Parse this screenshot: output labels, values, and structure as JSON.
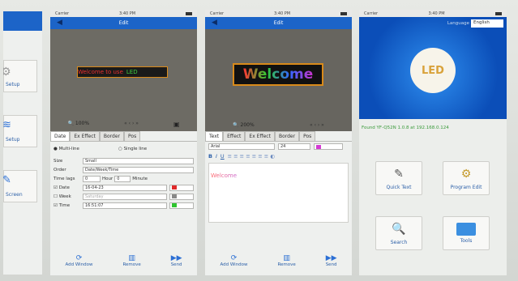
{
  "left_screen": {
    "menu_items": [
      {
        "label": "Setup",
        "icon": "gear-icon"
      },
      {
        "label": "Setup",
        "icon": "wifi-icon"
      },
      {
        "label": "Screen",
        "icon": "pencil-icon"
      }
    ]
  },
  "screen2": {
    "status_carrier": "Carrier",
    "status_time": "3:40 PM",
    "title": "Edit",
    "preview_text": "Welcome to use",
    "preview_text2": "LED",
    "zoom_label": "100%",
    "tabs": [
      "Date",
      "Ex Effect",
      "Border",
      "Pos"
    ],
    "radio_multiline": "Multi-line",
    "radio_singleline": "Single line",
    "size_label": "Size",
    "size_value": "Small",
    "order_label": "Order",
    "order_value": "Date/Week/Time",
    "timelag_label": "Time lags",
    "timelag_day": "0",
    "timelag_hour_label": "Hour",
    "timelag_hour": "0",
    "timelag_minute_label": "Minute",
    "date_label": "Date",
    "date_value": "16-04-23",
    "week_label": "Week",
    "week_value": "Saturday",
    "time_label": "Time",
    "time_value": "16:51:07",
    "bottom_buttons": [
      "Add Window",
      "Remove",
      "Send"
    ]
  },
  "screen3": {
    "status_carrier": "Carrier",
    "status_time": "3:40 PM",
    "title": "Edit",
    "preview_text": "Welcome",
    "zoom_label": "200%",
    "tabs": [
      "Text",
      "Effect",
      "Ex Effect",
      "Border",
      "Pos"
    ],
    "font_value": "Arial",
    "font_size": "24",
    "editor_text": "Welcome",
    "bottom_buttons": [
      "Add Window",
      "Remove",
      "Send"
    ]
  },
  "screen4": {
    "status_carrier": "Carrier",
    "status_time": "3:40 PM",
    "lang_label": "Language",
    "lang_value": "English",
    "logo_text": "LED",
    "found_text": "Found YF-Q52N 1.0.8 at 192.168.0.124",
    "tiles": [
      "Quick Text",
      "Program Edit",
      "Search",
      "Tools"
    ]
  },
  "colors": {
    "nav_blue": "#1c64c8",
    "welcome_gradient": [
      "#ff3333",
      "#33cc33",
      "#3366ff",
      "#cc33cc"
    ]
  }
}
